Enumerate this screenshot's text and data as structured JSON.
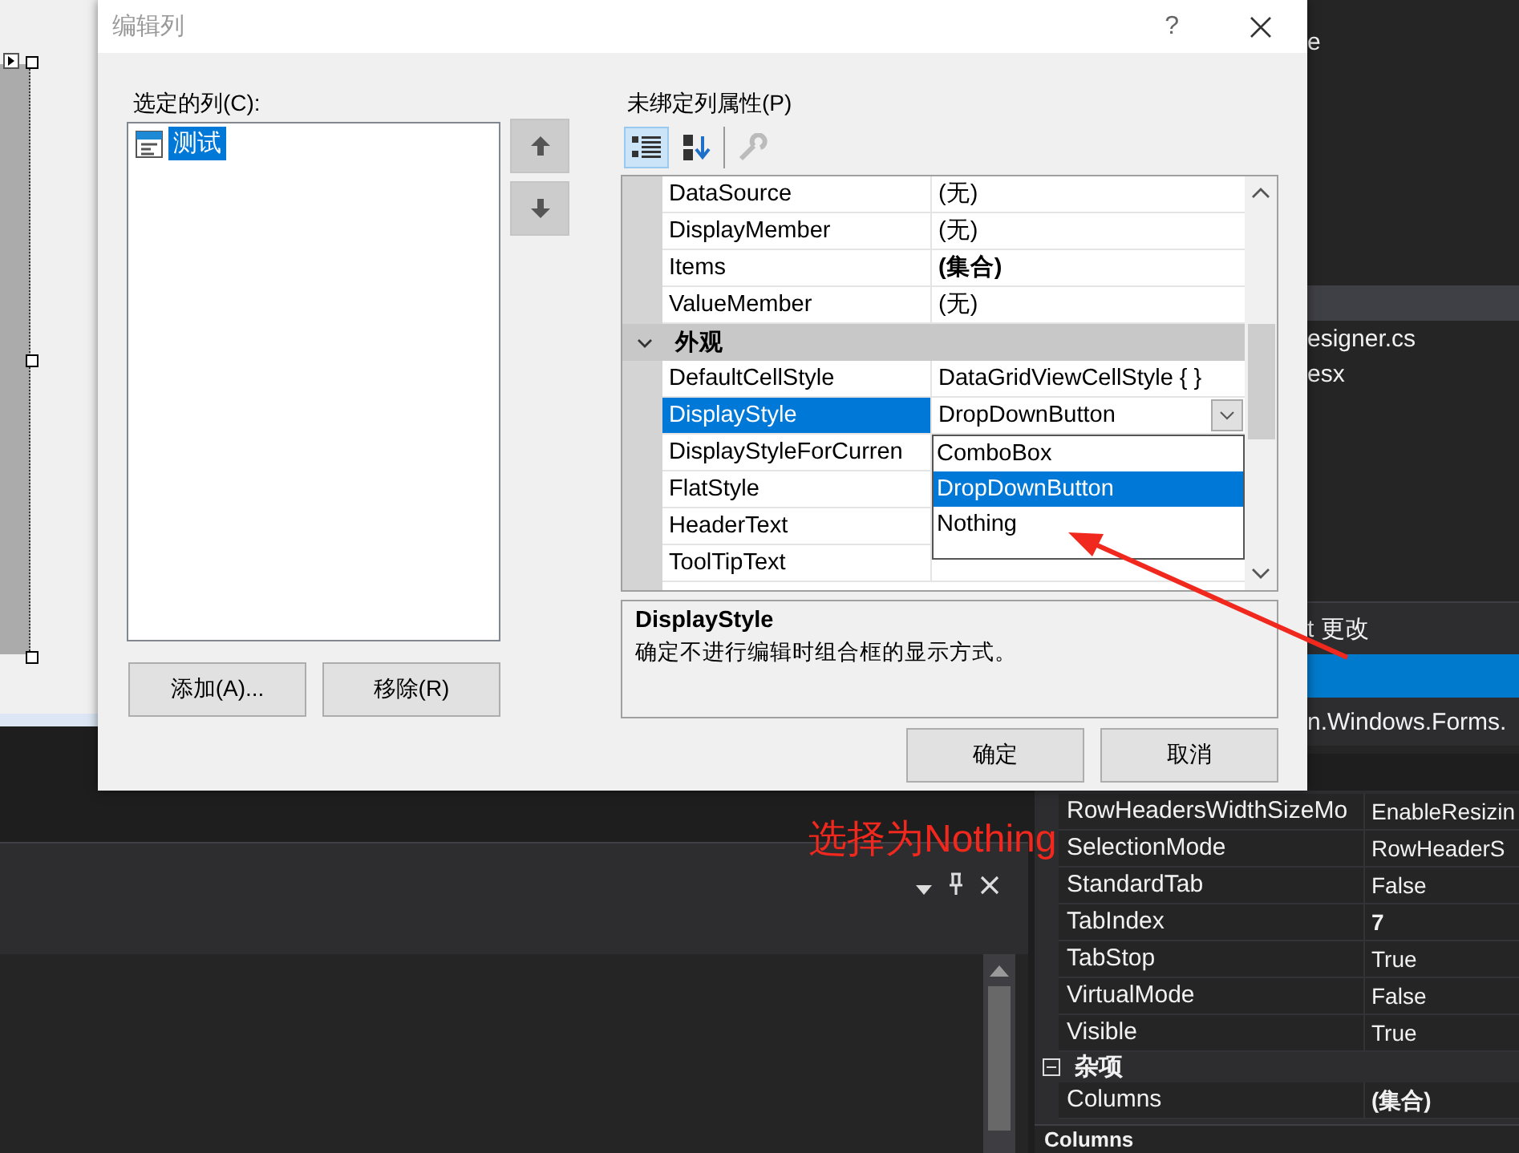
{
  "ide": {
    "explorer": {
      "items": [
        {
          "label": "e"
        },
        {
          "label": "esigner.cs"
        },
        {
          "label": "esx"
        }
      ]
    },
    "changes": {
      "label": "t 更改"
    },
    "progress": {
      "level": 1
    },
    "type_name": "n.Windows.Forms.",
    "properties": {
      "rows": [
        {
          "kind": "property",
          "name": "RowHeadersWidthSizeMo",
          "value": "EnableResizin",
          "bold": false
        },
        {
          "kind": "property",
          "name": "SelectionMode",
          "value": "RowHeaderS",
          "bold": false
        },
        {
          "kind": "property",
          "name": "StandardTab",
          "value": "False",
          "bold": false
        },
        {
          "kind": "property",
          "name": "TabIndex",
          "value": "7",
          "bold": true
        },
        {
          "kind": "property",
          "name": "TabStop",
          "value": "True",
          "bold": false
        },
        {
          "kind": "property",
          "name": "VirtualMode",
          "value": "False",
          "bold": false
        },
        {
          "kind": "property",
          "name": "Visible",
          "value": "True",
          "bold": false
        },
        {
          "kind": "category",
          "label": "杂项",
          "expanded": true
        },
        {
          "kind": "property",
          "name": "Columns",
          "value": "(集合)",
          "bold": true
        }
      ],
      "description_title": "Columns"
    }
  },
  "dialog": {
    "title": "编辑列",
    "help": "?",
    "columns_label": "选定的列(C):",
    "columns": [
      {
        "label": "测试",
        "selected": true
      }
    ],
    "add_button": "添加(A)...",
    "remove_button": "移除(R)",
    "properties_label": "未绑定列属性(P)",
    "toolbar": [
      {
        "kind": "categorized",
        "selected": true,
        "disabled": false
      },
      {
        "kind": "alphabetical",
        "selected": false,
        "disabled": false
      },
      {
        "kind": "property-pages",
        "selected": false,
        "disabled": true
      }
    ],
    "properties": [
      {
        "kind": "property",
        "name": "DataSource",
        "value": "(无)",
        "bold": false,
        "selected": false
      },
      {
        "kind": "property",
        "name": "DisplayMember",
        "value": "(无)",
        "bold": false,
        "selected": false
      },
      {
        "kind": "property",
        "name": "Items",
        "value": "(集合)",
        "bold": true,
        "selected": false
      },
      {
        "kind": "property",
        "name": "ValueMember",
        "value": "(无)",
        "bold": false,
        "selected": false
      },
      {
        "kind": "category",
        "label": "外观",
        "expanded": true
      },
      {
        "kind": "property",
        "name": "DefaultCellStyle",
        "value": "DataGridViewCellStyle { }",
        "bold": false,
        "selected": false
      },
      {
        "kind": "property",
        "name": "DisplayStyle",
        "value": "DropDownButton",
        "bold": false,
        "selected": true
      },
      {
        "kind": "property",
        "name": "DisplayStyleForCurren",
        "selected": false
      },
      {
        "kind": "property",
        "name": "FlatStyle",
        "selected": false
      },
      {
        "kind": "property",
        "name": "HeaderText",
        "selected": false
      },
      {
        "kind": "property",
        "name": "ToolTipText",
        "selected": false
      }
    ],
    "dropdown": {
      "options": [
        {
          "label": "ComboBox",
          "selected": false
        },
        {
          "label": "DropDownButton",
          "selected": true
        },
        {
          "label": "Nothing",
          "selected": false
        }
      ]
    },
    "description": {
      "title": "DisplayStyle",
      "text": "确定不进行编辑时组合框的显示方式。"
    },
    "ok_button": "确定",
    "cancel_button": "取消"
  },
  "annotation": {
    "text": "选择为Nothing"
  }
}
